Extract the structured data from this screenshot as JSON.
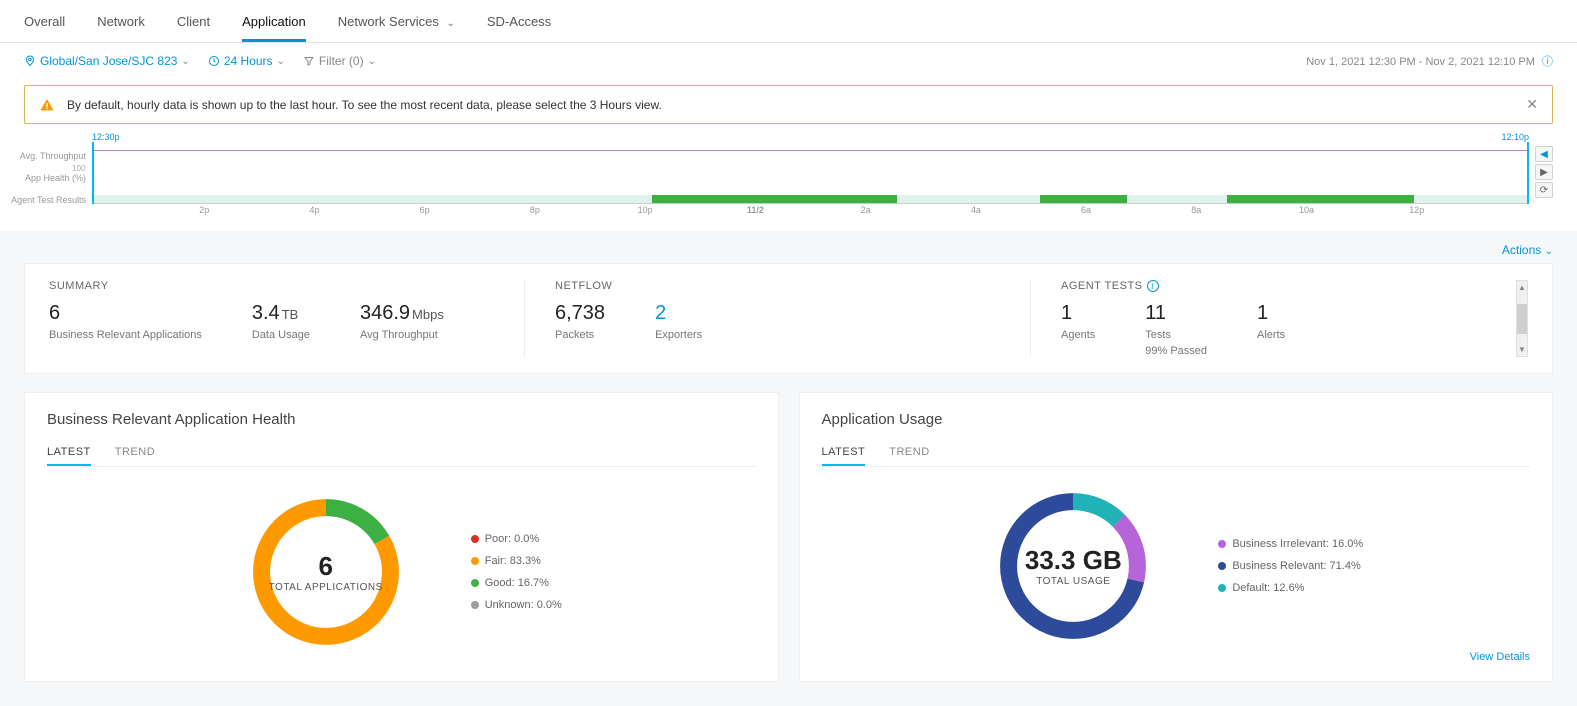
{
  "tabs": {
    "overall": "Overall",
    "network": "Network",
    "client": "Client",
    "application": "Application",
    "network_services": "Network Services",
    "sd_access": "SD-Access"
  },
  "toolbar": {
    "location": "Global/San Jose/SJC 823",
    "timerange": "24 Hours",
    "filter": "Filter (0)",
    "daterange": "Nov 1, 2021 12:30 PM - Nov 2, 2021 12:10 PM"
  },
  "alert": {
    "text": "By default, hourly data is shown up to the last hour. To see the most recent data, please select the 3 Hours view."
  },
  "timeline": {
    "start_label": "12:30p",
    "end_label": "12:10p",
    "ylabels": {
      "a": "Avg. Throughput",
      "b": "App Health (%)",
      "c": "Agent Test Results"
    },
    "tick100": "100",
    "xticks": [
      "2p",
      "4p",
      "6p",
      "8p",
      "10p",
      "11/2",
      "2a",
      "4a",
      "6a",
      "8a",
      "10a",
      "12p"
    ]
  },
  "actions_label": "Actions",
  "summary": {
    "title": "SUMMARY",
    "items": {
      "apps": {
        "value": "6",
        "unit": "",
        "label": "Business Relevant Applications"
      },
      "data": {
        "value": "3.4",
        "unit": "TB",
        "label": "Data Usage"
      },
      "throughput": {
        "value": "346.9",
        "unit": "Mbps",
        "label": "Avg Throughput"
      }
    }
  },
  "netflow": {
    "title": "NETFLOW",
    "packets": {
      "value": "6,738",
      "label": "Packets"
    },
    "exporters": {
      "value": "2",
      "label": "Exporters"
    }
  },
  "agent_tests": {
    "title": "AGENT TESTS",
    "agents": {
      "value": "1",
      "label": "Agents"
    },
    "tests": {
      "value": "11",
      "label": "Tests",
      "sub": "99% Passed"
    },
    "alerts": {
      "value": "1",
      "label": "Alerts"
    }
  },
  "health_panel": {
    "title": "Business Relevant Application Health",
    "tabs": {
      "latest": "LATEST",
      "trend": "TREND"
    },
    "center_value": "6",
    "center_label": "TOTAL APPLICATIONS",
    "legend": {
      "poor": {
        "label": "Poor: 0.0%",
        "color": "#d93025"
      },
      "fair": {
        "label": "Fair: 83.3%",
        "color": "#ff9900"
      },
      "good": {
        "label": "Good: 16.7%",
        "color": "#3cb043"
      },
      "unknown": {
        "label": "Unknown: 0.0%",
        "color": "#9e9e9e"
      }
    }
  },
  "usage_panel": {
    "title": "Application Usage",
    "tabs": {
      "latest": "LATEST",
      "trend": "TREND"
    },
    "center_value": "33.3 GB",
    "center_label": "TOTAL USAGE",
    "legend": {
      "irrelevant": {
        "label": "Business Irrelevant: 16.0%",
        "color": "#b565d8"
      },
      "relevant": {
        "label": "Business Relevant: 71.4%",
        "color": "#2d4b9a"
      },
      "default": {
        "label": "Default: 12.6%",
        "color": "#1fb2b7"
      }
    },
    "view_details": "View Details"
  },
  "chart_data": [
    {
      "type": "pie",
      "title": "Business Relevant Application Health",
      "series": [
        {
          "name": "Poor",
          "value": 0.0,
          "color": "#d93025"
        },
        {
          "name": "Fair",
          "value": 83.3,
          "color": "#ff9900"
        },
        {
          "name": "Good",
          "value": 16.7,
          "color": "#3cb043"
        },
        {
          "name": "Unknown",
          "value": 0.0,
          "color": "#9e9e9e"
        }
      ],
      "center": "6 TOTAL APPLICATIONS"
    },
    {
      "type": "pie",
      "title": "Application Usage",
      "series": [
        {
          "name": "Business Irrelevant",
          "value": 16.0,
          "color": "#b565d8"
        },
        {
          "name": "Business Relevant",
          "value": 71.4,
          "color": "#2d4b9a"
        },
        {
          "name": "Default",
          "value": 12.6,
          "color": "#1fb2b7"
        }
      ],
      "center": "33.3 GB TOTAL USAGE"
    },
    {
      "type": "line",
      "title": "Timeline",
      "x": [
        "12:30p",
        "2p",
        "4p",
        "6p",
        "8p",
        "10p",
        "11/2",
        "2a",
        "4a",
        "6a",
        "8a",
        "10a",
        "12p",
        "12:10p"
      ],
      "ylabels": [
        "Avg. Throughput",
        "App Health (%)",
        "Agent Test Results"
      ],
      "ylim": [
        0,
        100
      ]
    }
  ]
}
